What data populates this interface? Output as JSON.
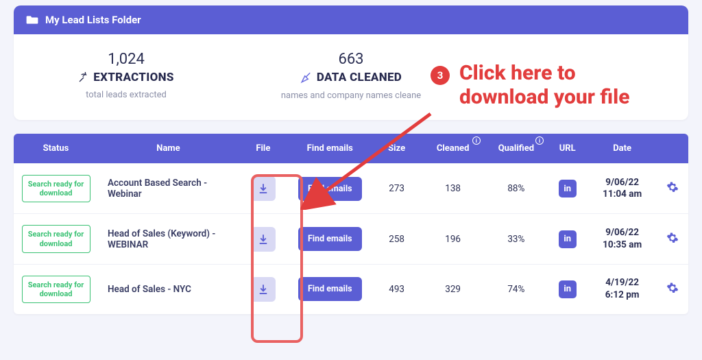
{
  "header": {
    "title": "My Lead Lists Folder"
  },
  "stats": {
    "extractions": {
      "count": "1,024",
      "title": "EXTRACTIONS",
      "sub": "total leads extracted"
    },
    "cleaned": {
      "count": "663",
      "title": "DATA CLEANED",
      "sub": "names and company names cleane"
    }
  },
  "table": {
    "headers": {
      "status": "Status",
      "name": "Name",
      "file": "File",
      "find": "Find emails",
      "size": "Size",
      "cleaned": "Cleaned",
      "qualified": "Qualified",
      "url": "URL",
      "date": "Date"
    },
    "status_label": "Search ready for download",
    "find_label": "Find emails",
    "rows": [
      {
        "name": "Account Based Search - Webinar",
        "size": "273",
        "cleaned": "138",
        "qualified": "88%",
        "date1": "9/06/22",
        "date2": "11:04 am"
      },
      {
        "name": "Head of Sales (Keyword) - WEBINAR",
        "size": "258",
        "cleaned": "196",
        "qualified": "33%",
        "date1": "9/06/22",
        "date2": "10:35 am"
      },
      {
        "name": "Head of Sales - NYC",
        "size": "493",
        "cleaned": "329",
        "qualified": "74%",
        "date1": "4/19/22",
        "date2": "6:12 pm"
      }
    ]
  },
  "annotation": {
    "number": "3",
    "line1": "Click here to",
    "line2": "download your file"
  }
}
